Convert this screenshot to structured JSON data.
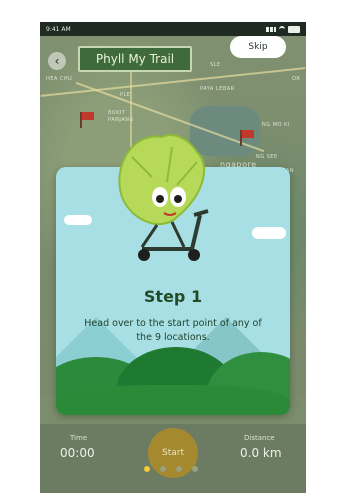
{
  "status_bar": {
    "time": "9:41 AM"
  },
  "header": {
    "title": "Phyll My Trail",
    "skip_label": "Skip",
    "back_icon": "chevron-left-icon"
  },
  "map_labels": [
    "HEA CHU",
    "BUKIT",
    "PANJANG",
    "PLE",
    "SLE",
    "PAYA LEBAR",
    "NG MO KI",
    "NG SEE",
    "ISHAN",
    "ngapore",
    "OR"
  ],
  "card": {
    "title": "Step 1",
    "text": "Head over to the start point of any of the 9 locations."
  },
  "stats": {
    "time_label": "Time",
    "time_value": "00:00",
    "distance_label": "Distance",
    "distance_value": "0.0 km"
  },
  "start_label": "Start",
  "pager": {
    "count": 4,
    "active_index": 0
  },
  "colors": {
    "accent": "#f3c936",
    "sign_green": "#3f6b3a",
    "card_bg": "#a7dfe4"
  }
}
